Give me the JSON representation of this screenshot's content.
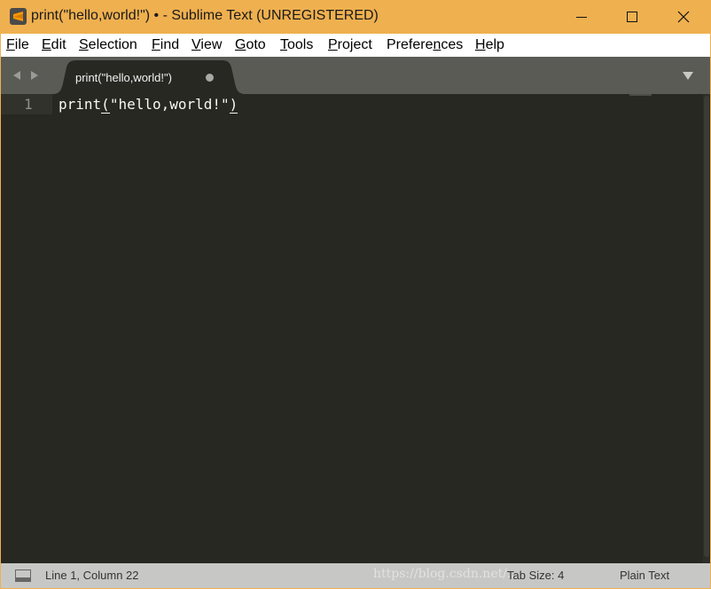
{
  "window": {
    "title": "print(\"hello,world!\") • - Sublime Text (UNREGISTERED)",
    "icon": "sublime-text-logo"
  },
  "menu": {
    "items": [
      {
        "mnemonic": "F",
        "rest": "ile"
      },
      {
        "mnemonic": "E",
        "rest": "dit"
      },
      {
        "mnemonic": "S",
        "rest": "election"
      },
      {
        "mnemonic": "F",
        "rest": "ind"
      },
      {
        "mnemonic": "V",
        "rest": "iew"
      },
      {
        "mnemonic": "G",
        "rest": "oto"
      },
      {
        "mnemonic": "T",
        "rest": "ools"
      },
      {
        "mnemonic": "P",
        "rest": "roject"
      },
      {
        "pre": "Prefere",
        "mnemonic": "n",
        "rest": "ces"
      },
      {
        "mnemonic": "H",
        "rest": "elp"
      }
    ]
  },
  "tabs": [
    {
      "label": "print(\"hello,world!\")",
      "modified": true
    }
  ],
  "editor": {
    "lines": [
      {
        "number": "1",
        "code_open": "print",
        "open_bracket": "(",
        "string": "\"hello,world!\"",
        "close_bracket": ")"
      }
    ]
  },
  "status": {
    "position": "Line 1, Column 22",
    "watermark": "https://blog.csdn.net/...",
    "tab_size": "Tab Size: 4",
    "syntax": "Plain Text"
  },
  "colors": {
    "titlebar": "#efb04f",
    "editor_bg": "#272822",
    "editor_fg": "#f8f8f2",
    "tabbar": "#5b5b56",
    "statusbar": "#c7c8c6"
  }
}
